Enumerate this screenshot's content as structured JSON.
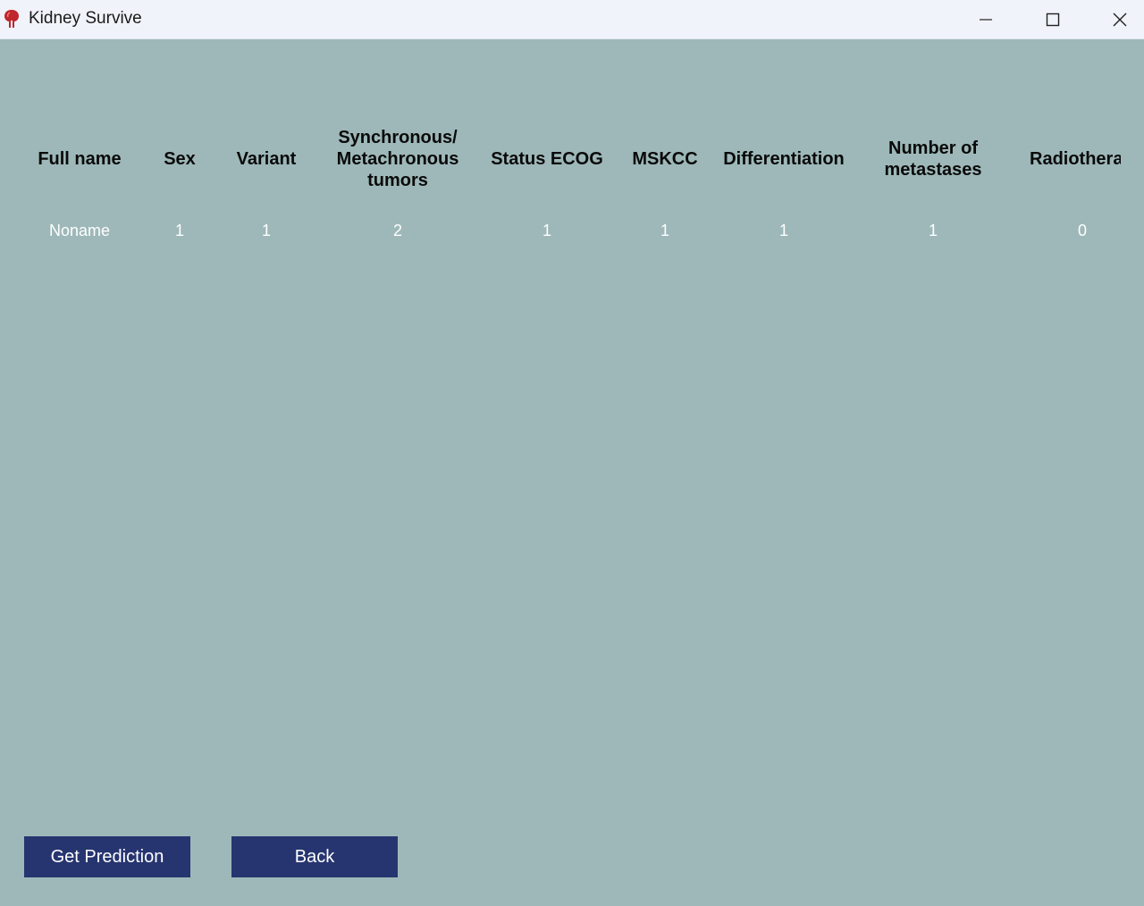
{
  "window": {
    "title": "Kidney Survive",
    "icon": "kidney-icon",
    "controls": {
      "minimize_icon": "minimize-icon",
      "maximize_icon": "maximize-icon",
      "close_icon": "close-icon"
    }
  },
  "colors": {
    "background": "#9eb8b9",
    "button": "#263570",
    "titlebar": "#f0f3f9"
  },
  "table": {
    "headers": [
      "Full name",
      "Sex",
      "Variant",
      "Synchronous/ Metachronous tumors",
      "Status ECOG",
      "MSKCC",
      "Differentiation",
      "Number of metastases",
      "Radiotherap"
    ],
    "rows": [
      [
        "Noname",
        "1",
        "1",
        "2",
        "1",
        "1",
        "1",
        "1",
        "0"
      ]
    ]
  },
  "actions": {
    "predict_label": "Get Prediction",
    "back_label": "Back"
  }
}
